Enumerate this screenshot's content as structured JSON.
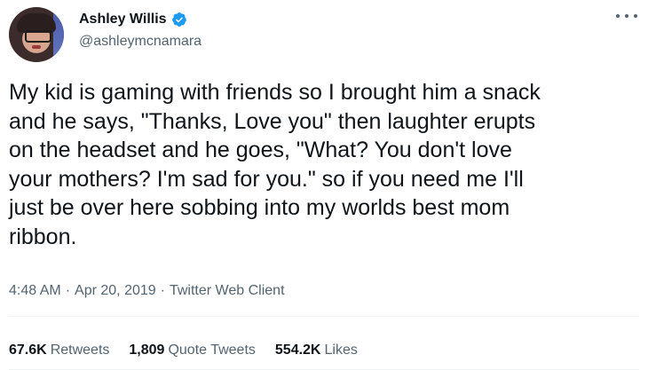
{
  "author": {
    "display_name": "Ashley Willis",
    "handle": "@ashleymcnamara",
    "verified": true,
    "verified_color": "#1d9bf0"
  },
  "tweet": {
    "lines": [
      "My kid is gaming with friends so I brought him a snack",
      "and he says, \"Thanks, Love you\" then laughter erupts",
      "on the headset and he goes, \"What? You don't love",
      "your mothers? I'm sad for you.\" so if you need me I'll",
      "just be over here sobbing into my worlds best mom",
      "ribbon."
    ],
    "time": "4:48 AM",
    "date": "Apr 20, 2019",
    "client": "Twitter Web Client",
    "separator": "·"
  },
  "stats": {
    "retweets_count": "67.6K",
    "retweets_label": "Retweets",
    "quotes_count": "1,809",
    "quotes_label": "Quote Tweets",
    "likes_count": "554.2K",
    "likes_label": "Likes"
  }
}
